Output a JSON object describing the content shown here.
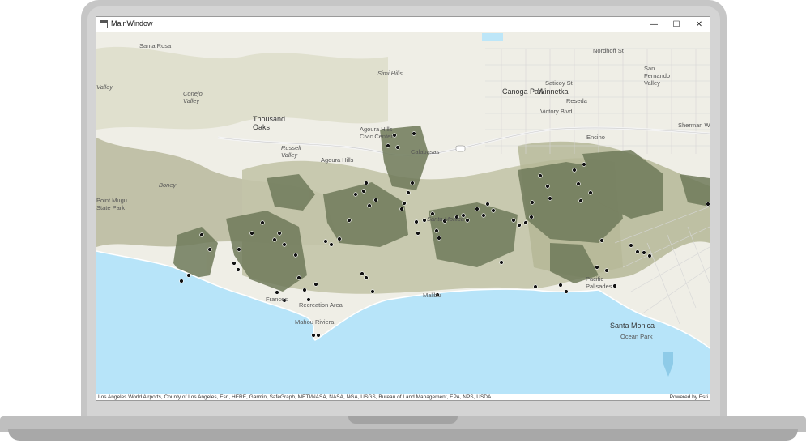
{
  "window": {
    "title": "MainWindow",
    "minimize_glyph": "—",
    "maximize_glyph": "☐",
    "close_glyph": "✕"
  },
  "map": {
    "places": [
      {
        "id": "thousand-oaks",
        "text": "Thousand\nOaks"
      },
      {
        "id": "simi-hills",
        "text": "Simi Hills"
      },
      {
        "id": "conejo-valley",
        "text": "Conejo\nValley"
      },
      {
        "id": "russell-valley",
        "text": "Russell\nValley"
      },
      {
        "id": "agoura-hills",
        "text": "Agoura Hills"
      },
      {
        "id": "agoura-hills-civic",
        "text": "Agoura Hills\nCivic Center"
      },
      {
        "id": "calabasas",
        "text": "Calabasas"
      },
      {
        "id": "canoga-park",
        "text": "Canoga Park"
      },
      {
        "id": "winnetka",
        "text": "Winnetka"
      },
      {
        "id": "reseda",
        "text": "Reseda"
      },
      {
        "id": "encino",
        "text": "Encino"
      },
      {
        "id": "san-fernando-valley",
        "text": "San\nFernando\nValley"
      },
      {
        "id": "boney",
        "text": "Boney"
      },
      {
        "id": "santa-monica-mtns",
        "text": "Santa Monica"
      },
      {
        "id": "pacific-palisades",
        "text": "Pacific\nPalisades"
      },
      {
        "id": "santa-monica",
        "text": "Santa Monica"
      },
      {
        "id": "ocean-park",
        "text": "Ocean Park"
      },
      {
        "id": "malibu",
        "text": "Malibu"
      },
      {
        "id": "mahou-riviera",
        "text": "Mahou Riviera"
      },
      {
        "id": "recreation-area",
        "text": "Recreation Area"
      },
      {
        "id": "frances",
        "text": "Frances"
      },
      {
        "id": "point-mugu",
        "text": "Point Mugu\nState Park"
      },
      {
        "id": "victory-blvd",
        "text": "Victory Blvd"
      },
      {
        "id": "valley",
        "text": "Valley"
      },
      {
        "id": "santa-rosa",
        "text": "Santa Rosa"
      },
      {
        "id": "northoff",
        "text": "Nordhoff St"
      },
      {
        "id": "saticoy",
        "text": "Saticoy St"
      },
      {
        "id": "sherman",
        "text": "Sherman Way"
      }
    ]
  },
  "attribution": {
    "sources": "Los Angeles World Airports, County of Los Angeles, Esri, HERE, Garmin, SafeGraph, METI/NASA, NASA, NGA, USGS, Bureau of Land Management, EPA, NPS, USDA",
    "powered_by": "Powered by Esri"
  },
  "colors": {
    "ocean": "#b7e4f9",
    "land": "#efeee6",
    "park": "#7a8466",
    "hills": "#c9c9b2",
    "point": "#111111"
  }
}
